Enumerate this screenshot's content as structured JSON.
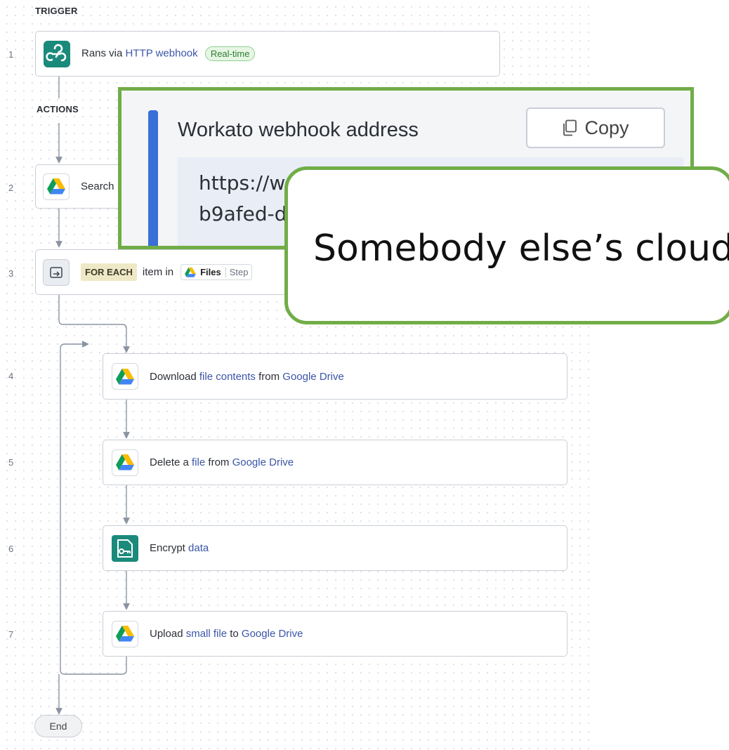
{
  "sections": {
    "trigger": "TRIGGER",
    "actions": "ACTIONS"
  },
  "step_numbers": [
    "1",
    "2",
    "3",
    "4",
    "5",
    "6",
    "7"
  ],
  "steps": {
    "s1": {
      "prefix": "Rans via ",
      "link": "HTTP webhook",
      "badge": "Real-time"
    },
    "s2": {
      "text": "Search"
    },
    "s3": {
      "tag": "FOR EACH",
      "text": "item in",
      "pill_name": "Files",
      "pill_step": "Step"
    },
    "s4": {
      "verb": "Download ",
      "obj": "file contents",
      "mid": " from ",
      "app": "Google Drive"
    },
    "s5": {
      "verb": "Delete a ",
      "obj": "file",
      "mid": " from ",
      "app": "Google Drive"
    },
    "s6": {
      "verb": "Encrypt ",
      "obj": "data"
    },
    "s7": {
      "verb": "Upload ",
      "obj": "small file",
      "mid": " to ",
      "app": "Google Drive"
    }
  },
  "end_label": "End",
  "callout": {
    "heading": "Workato webhook address",
    "copy_label": "Copy",
    "url_line1": "https://w",
    "url_line2": "b9afed-d"
  },
  "caption": "Somebody else’s cloud",
  "colors": {
    "accent_green": "#70ad47",
    "link_blue": "#3b55a8",
    "callout_bar": "#3a6fd8",
    "webhook_teal": "#1b8a7a"
  },
  "icons": [
    "webhook-icon",
    "google-drive-icon",
    "loop-icon",
    "key-file-icon",
    "copy-icon"
  ]
}
